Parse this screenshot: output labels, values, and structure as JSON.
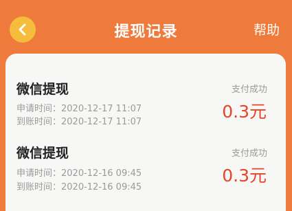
{
  "header": {
    "title": "提现记录",
    "help_label": "帮助",
    "back_icon": "chevron-left-icon"
  },
  "colors": {
    "header_bg": "#ee7a3b",
    "back_button_bg": "#f6bd3c",
    "amount": "#e8442a"
  },
  "records": [
    {
      "title": "微信提现",
      "apply_time": "申请时间：2020-12-17 11:07",
      "arrive_time": "到账时间：2020-12-17 11:07",
      "status": "支付成功",
      "amount": "0.3元"
    },
    {
      "title": "微信提现",
      "apply_time": "申请时间：2020-12-16 09:45",
      "arrive_time": "到账时间：2020-12-16 09:45",
      "status": "支付成功",
      "amount": "0.3元"
    }
  ]
}
